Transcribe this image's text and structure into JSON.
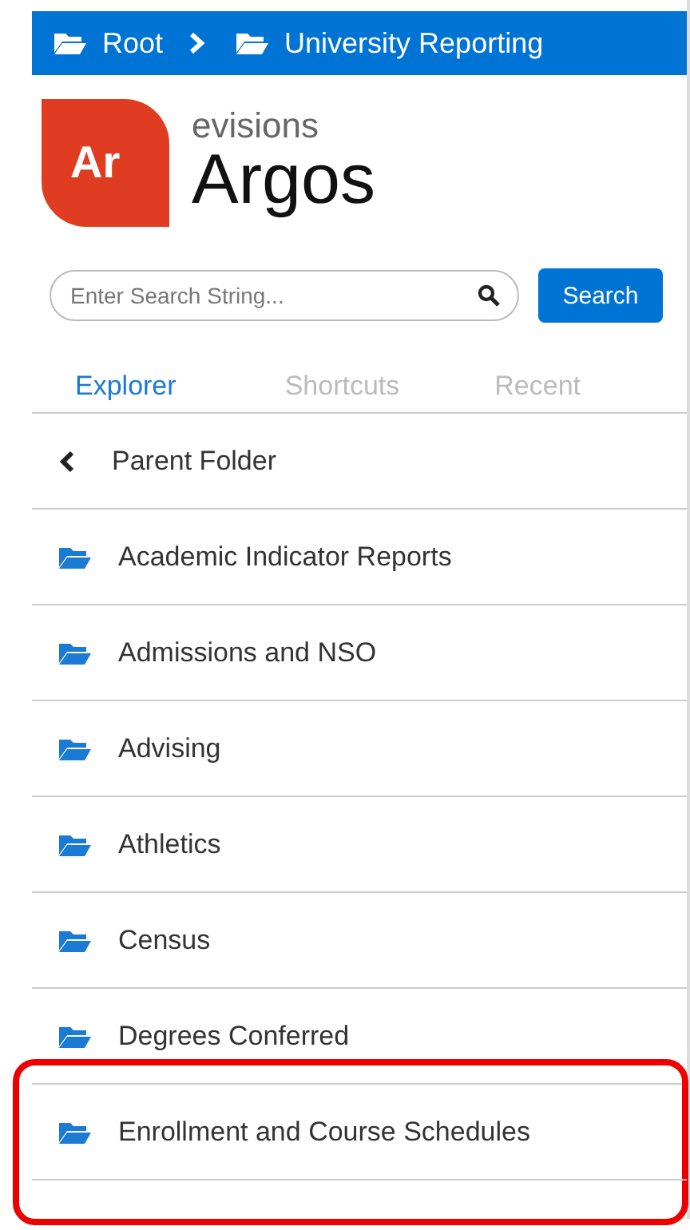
{
  "breadcrumb": [
    {
      "label": "Root"
    },
    {
      "label": "University Reporting"
    }
  ],
  "logo": {
    "badge": "Ar",
    "brand": "evisions",
    "product": "Argos"
  },
  "search": {
    "placeholder": "Enter Search String...",
    "button": "Search"
  },
  "tabs": [
    {
      "label": "Explorer",
      "selected": true
    },
    {
      "label": "Shortcuts",
      "selected": false
    },
    {
      "label": "Recent",
      "selected": false
    }
  ],
  "items": [
    {
      "kind": "parent",
      "label": "Parent Folder",
      "highlighted": false
    },
    {
      "kind": "folder",
      "label": "Academic Indicator Reports",
      "highlighted": false
    },
    {
      "kind": "folder",
      "label": "Admissions and NSO",
      "highlighted": false
    },
    {
      "kind": "folder",
      "label": "Advising",
      "highlighted": false
    },
    {
      "kind": "folder",
      "label": "Athletics",
      "highlighted": false
    },
    {
      "kind": "folder",
      "label": "Census",
      "highlighted": false
    },
    {
      "kind": "folder",
      "label": "Degrees Conferred",
      "highlighted": false
    },
    {
      "kind": "folder",
      "label": "Enrollment and Course Schedules",
      "highlighted": true
    }
  ]
}
